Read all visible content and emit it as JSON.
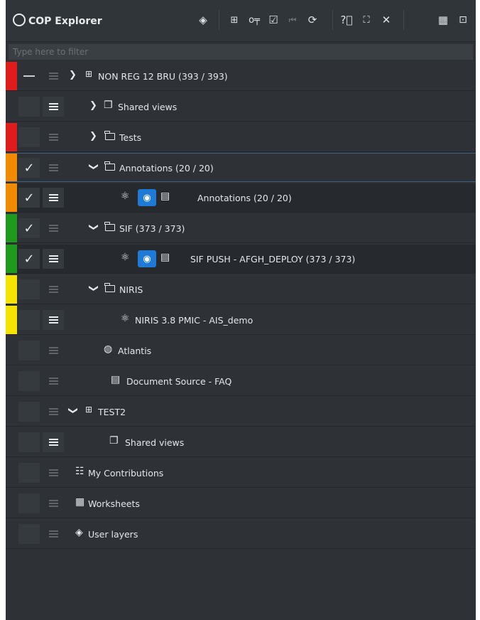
{
  "header": {
    "title": "COP Explorer",
    "icons": [
      "compass-icon",
      "layers-icon",
      "tree-icon",
      "key-icon",
      "checkbox-icon",
      "first-icon",
      "refresh-icon",
      "help-icon",
      "expand-icon",
      "close-icon",
      "grid-icon",
      "dock-icon"
    ]
  },
  "filter": {
    "placeholder": "Type here to filter",
    "value": ""
  },
  "colors": {
    "red": "#e01b1b",
    "orange": "#f08a00",
    "green": "#1f9a1f",
    "yellow": "#f5e400",
    "accent": "#1f7ad6"
  },
  "rows": [
    {
      "label": "NON REG 12 BRU (393 / 393)",
      "icon": "tree-icon",
      "expanded": true,
      "stripe": "red",
      "check": "dash"
    },
    {
      "label": "Shared views",
      "icon": "shared-views-icon",
      "expanded": false,
      "stripe": "none"
    },
    {
      "label": "Tests",
      "icon": "folder-icon",
      "expanded": false,
      "stripe": "red"
    },
    {
      "label": "Annotations (20 / 20)",
      "icon": "folder-icon",
      "expanded": true,
      "stripe": "orange",
      "check": "checked"
    },
    {
      "label": "Annotations (20 / 20)",
      "icon": "layer-icon",
      "stripe": "orange",
      "check": "checked"
    },
    {
      "label": "SIF (373 / 373)",
      "icon": "folder-icon",
      "expanded": true,
      "stripe": "green",
      "check": "checked"
    },
    {
      "label": "SIF PUSH - AFGH_DEPLOY (373 / 373)",
      "icon": "layer-icon",
      "stripe": "green",
      "check": "checked"
    },
    {
      "label": "NIRIS",
      "icon": "folder-icon",
      "expanded": true,
      "stripe": "yellow"
    },
    {
      "label": "NIRIS 3.8 PMIC - AIS_demo",
      "icon": "layer-icon",
      "stripe": "yellow"
    },
    {
      "label": "Atlantis",
      "icon": "globe-icon",
      "stripe": "none"
    },
    {
      "label": "Document Source - FAQ",
      "icon": "document-icon",
      "stripe": "none"
    },
    {
      "label": "TEST2",
      "icon": "tree-icon",
      "expanded": true,
      "stripe": "none"
    },
    {
      "label": "Shared views",
      "icon": "shared-views-icon",
      "stripe": "none"
    },
    {
      "label": "My Contributions",
      "icon": "users-icon",
      "stripe": "none"
    },
    {
      "label": "Worksheets",
      "icon": "table-icon",
      "stripe": "none"
    },
    {
      "label": "User layers",
      "icon": "layers-icon",
      "stripe": "none"
    }
  ]
}
